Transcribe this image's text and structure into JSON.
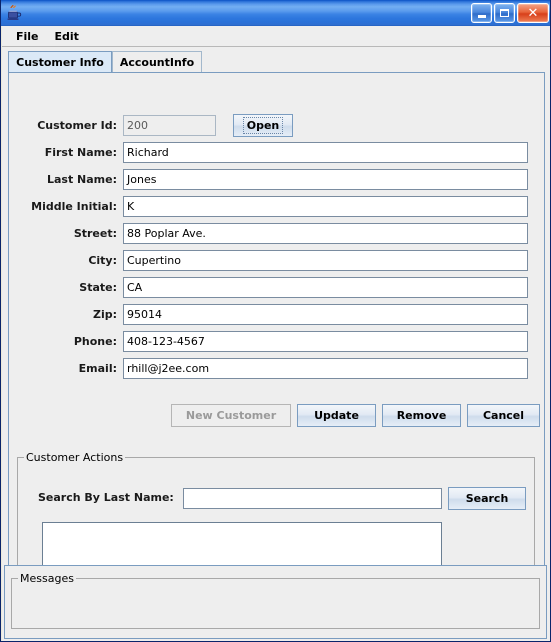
{
  "window": {
    "title": "",
    "icon": "java-coffee-cup-icon",
    "controls": {
      "minimize_label": "",
      "maximize_label": "",
      "close_label": "✕"
    }
  },
  "menubar": {
    "items": [
      {
        "label": "File"
      },
      {
        "label": "Edit"
      }
    ]
  },
  "tabs": [
    {
      "label": "Customer Info",
      "selected": true
    },
    {
      "label": "AccountInfo",
      "selected": false
    }
  ],
  "form": {
    "fields": [
      {
        "label": "Customer Id:",
        "value": "200",
        "placeholder": "",
        "readonly": true
      },
      {
        "label": "First Name:",
        "value": "Richard",
        "placeholder": "",
        "readonly": false
      },
      {
        "label": "Last Name:",
        "value": "Jones",
        "placeholder": "",
        "readonly": false
      },
      {
        "label": "Middle Initial:",
        "value": "K",
        "placeholder": "",
        "readonly": false
      },
      {
        "label": "Street:",
        "value": "88 Poplar Ave.",
        "placeholder": "",
        "readonly": false
      },
      {
        "label": "City:",
        "value": "Cupertino",
        "placeholder": "",
        "readonly": false
      },
      {
        "label": "State:",
        "value": "CA",
        "placeholder": "",
        "readonly": false
      },
      {
        "label": "Zip:",
        "value": "95014",
        "placeholder": "",
        "readonly": false
      },
      {
        "label": "Phone:",
        "value": "408-123-4567",
        "placeholder": "",
        "readonly": false
      },
      {
        "label": "Email:",
        "value": "rhill@j2ee.com",
        "placeholder": "",
        "readonly": false
      }
    ],
    "open_button": "Open"
  },
  "actions": {
    "new_customer": "New Customer",
    "update": "Update",
    "remove": "Remove",
    "cancel": "Cancel"
  },
  "customer_actions": {
    "group_title": "Customer Actions",
    "search_label": "Search By Last Name:",
    "search_value": "",
    "search_placeholder": "",
    "search_button": "Search",
    "results": []
  },
  "messages": {
    "group_title": "Messages",
    "text": ""
  },
  "colors": {
    "title_bar_blue": "#2f6cc9",
    "window_border": "#0a246a",
    "panel_bg": "#eeeeee",
    "tab_selected_bg": "#dbe9f7",
    "field_border": "#7a8ca0",
    "disabled_text": "#9a9a9a",
    "close_button_red": "#d8401a"
  }
}
